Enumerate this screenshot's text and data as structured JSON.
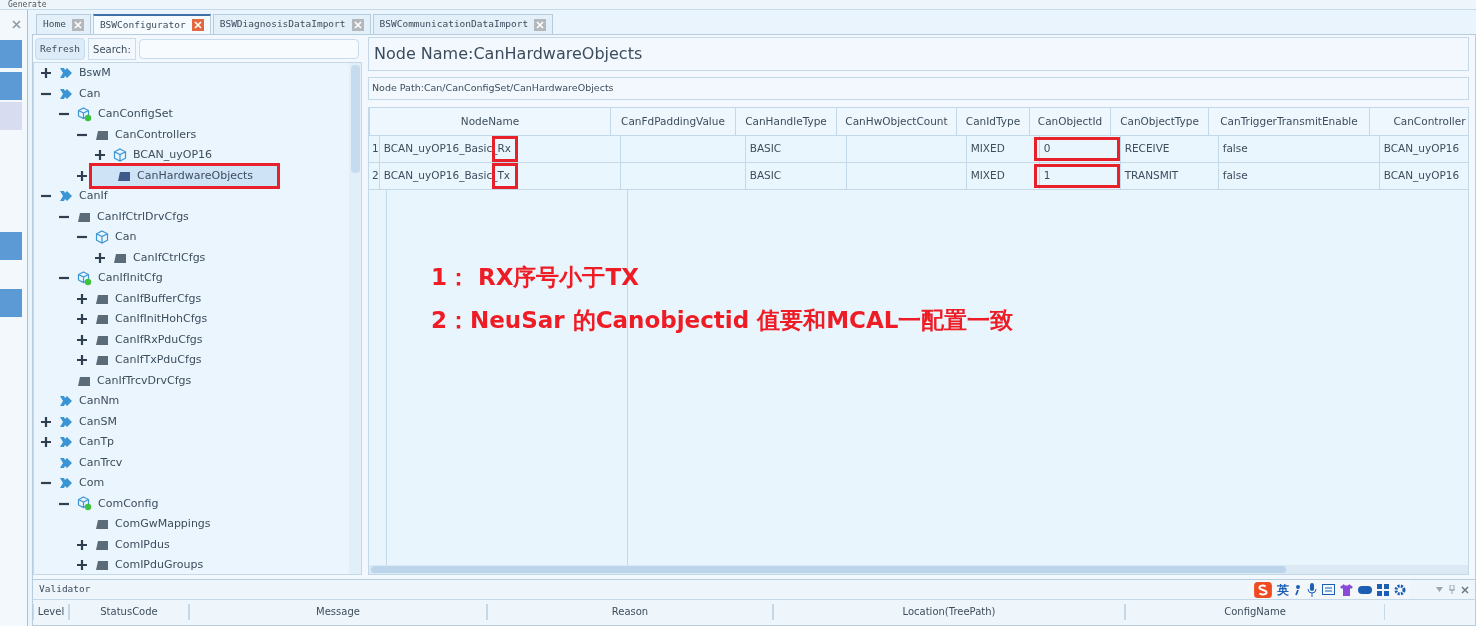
{
  "toolbar": {
    "label": "Generate"
  },
  "side_tabs": [
    {
      "selected": false
    },
    {
      "selected": false
    },
    {
      "selected": true
    },
    {
      "selected": false
    },
    {
      "selected": false
    }
  ],
  "tabs": [
    {
      "label": "Home",
      "selected": false
    },
    {
      "label": "BSWConfigurator",
      "selected": true
    },
    {
      "label": "BSWDiagnosisDataImport",
      "selected": false
    },
    {
      "label": "BSWCommunicationDataImport",
      "selected": false
    }
  ],
  "tree_toolbar": {
    "refresh": "Refresh",
    "search_label": "Search:"
  },
  "tree": [
    {
      "label": "BswM",
      "kind": "module",
      "expandable": true,
      "expanded": false,
      "selected": false,
      "annotated": false
    },
    {
      "label": "Can",
      "kind": "module",
      "expandable": true,
      "expanded": true,
      "selected": false,
      "annotated": false,
      "children": [
        {
          "label": "CanConfigSet",
          "kind": "config",
          "expandable": true,
          "expanded": true,
          "selected": false,
          "annotated": false,
          "children": [
            {
              "label": "CanControllers",
              "kind": "container",
              "expandable": true,
              "expanded": true,
              "selected": false,
              "annotated": false,
              "children": [
                {
                  "label": "BCAN_uyOP16",
                  "kind": "instance",
                  "expandable": true,
                  "expanded": false,
                  "selected": false,
                  "annotated": false
                }
              ]
            },
            {
              "label": "CanHardwareObjects",
              "kind": "container-blue",
              "expandable": true,
              "expanded": false,
              "selected": true,
              "annotated": true
            }
          ]
        }
      ]
    },
    {
      "label": "CanIf",
      "kind": "module",
      "expandable": true,
      "expanded": true,
      "selected": false,
      "annotated": false,
      "children": [
        {
          "label": "CanIfCtrlDrvCfgs",
          "kind": "container",
          "expandable": true,
          "expanded": true,
          "selected": false,
          "annotated": false,
          "children": [
            {
              "label": "Can",
              "kind": "instance",
              "expandable": true,
              "expanded": true,
              "selected": false,
              "annotated": false,
              "children": [
                {
                  "label": "CanIfCtrlCfgs",
                  "kind": "container",
                  "expandable": true,
                  "expanded": false,
                  "selected": false,
                  "annotated": false
                }
              ]
            }
          ]
        },
        {
          "label": "CanIfInitCfg",
          "kind": "config",
          "expandable": true,
          "expanded": true,
          "selected": false,
          "annotated": false,
          "children": [
            {
              "label": "CanIfBufferCfgs",
              "kind": "container",
              "expandable": true,
              "expanded": false,
              "selected": false,
              "annotated": false
            },
            {
              "label": "CanIfInitHohCfgs",
              "kind": "container",
              "expandable": true,
              "expanded": false,
              "selected": false,
              "annotated": false
            },
            {
              "label": "CanIfRxPduCfgs",
              "kind": "container",
              "expandable": true,
              "expanded": false,
              "selected": false,
              "annotated": false
            },
            {
              "label": "CanIfTxPduCfgs",
              "kind": "container",
              "expandable": true,
              "expanded": false,
              "selected": false,
              "annotated": false
            }
          ]
        },
        {
          "label": "CanIfTrcvDrvCfgs",
          "kind": "container",
          "expandable": false,
          "selected": false,
          "annotated": false
        }
      ]
    },
    {
      "label": "CanNm",
      "kind": "module",
      "expandable": false,
      "selected": false,
      "annotated": false
    },
    {
      "label": "CanSM",
      "kind": "module",
      "expandable": true,
      "expanded": false,
      "selected": false,
      "annotated": false
    },
    {
      "label": "CanTp",
      "kind": "module",
      "expandable": true,
      "expanded": false,
      "selected": false,
      "annotated": false
    },
    {
      "label": "CanTrcv",
      "kind": "module",
      "expandable": false,
      "selected": false,
      "annotated": false
    },
    {
      "label": "Com",
      "kind": "module",
      "expandable": true,
      "expanded": true,
      "selected": false,
      "annotated": false,
      "children": [
        {
          "label": "ComConfig",
          "kind": "config",
          "expandable": true,
          "expanded": true,
          "selected": false,
          "annotated": false,
          "children": [
            {
              "label": "ComGwMappings",
              "kind": "container",
              "expandable": false,
              "selected": false,
              "annotated": false
            },
            {
              "label": "ComIPdus",
              "kind": "container",
              "expandable": true,
              "expanded": false,
              "selected": false,
              "annotated": false
            },
            {
              "label": "ComIPduGroups",
              "kind": "container",
              "expandable": true,
              "expanded": false,
              "selected": false,
              "annotated": false
            }
          ]
        }
      ]
    }
  ],
  "node_name": "Node Name:CanHardwareObjects",
  "node_path": "Node Path:Can/CanConfigSet/CanHardwareObjects",
  "table": {
    "columns": [
      "NodeName",
      "CanFdPaddingValue",
      "CanHandleType",
      "CanHwObjectCount",
      "CanIdType",
      "CanObjectId",
      "CanObjectType",
      "CanTriggerTransmitEnable",
      "CanController"
    ],
    "rows": [
      {
        "index": "1",
        "cells": [
          {
            "text": "BCAN_uyOP16_Basic_Rx",
            "annotated": true
          },
          {
            "text": ""
          },
          {
            "text": "BASIC"
          },
          {
            "text": ""
          },
          {
            "text": "MIXED"
          },
          {
            "text": "0",
            "annotated": true
          },
          {
            "text": "RECEIVE"
          },
          {
            "text": "false"
          },
          {
            "text": "BCAN_uyOP16"
          }
        ]
      },
      {
        "index": "2",
        "cells": [
          {
            "text": "BCAN_uyOP16_Basic_Tx",
            "annotated": true
          },
          {
            "text": ""
          },
          {
            "text": "BASIC"
          },
          {
            "text": ""
          },
          {
            "text": "MIXED"
          },
          {
            "text": "1",
            "annotated": true
          },
          {
            "text": "TRANSMIT"
          },
          {
            "text": "false"
          },
          {
            "text": "BCAN_uyOP16"
          }
        ]
      }
    ]
  },
  "annotations": [
    "1： RX序号小于TX",
    "2：NeuSar 的Canobjectid 值要和MCAL一配置一致"
  ],
  "validator": {
    "title": "Validator",
    "columns": [
      "Level",
      "StatusCode",
      "Message",
      "Reason",
      "Location(TreePath)",
      "ConfigName"
    ]
  },
  "ime": {
    "mode": "英"
  }
}
